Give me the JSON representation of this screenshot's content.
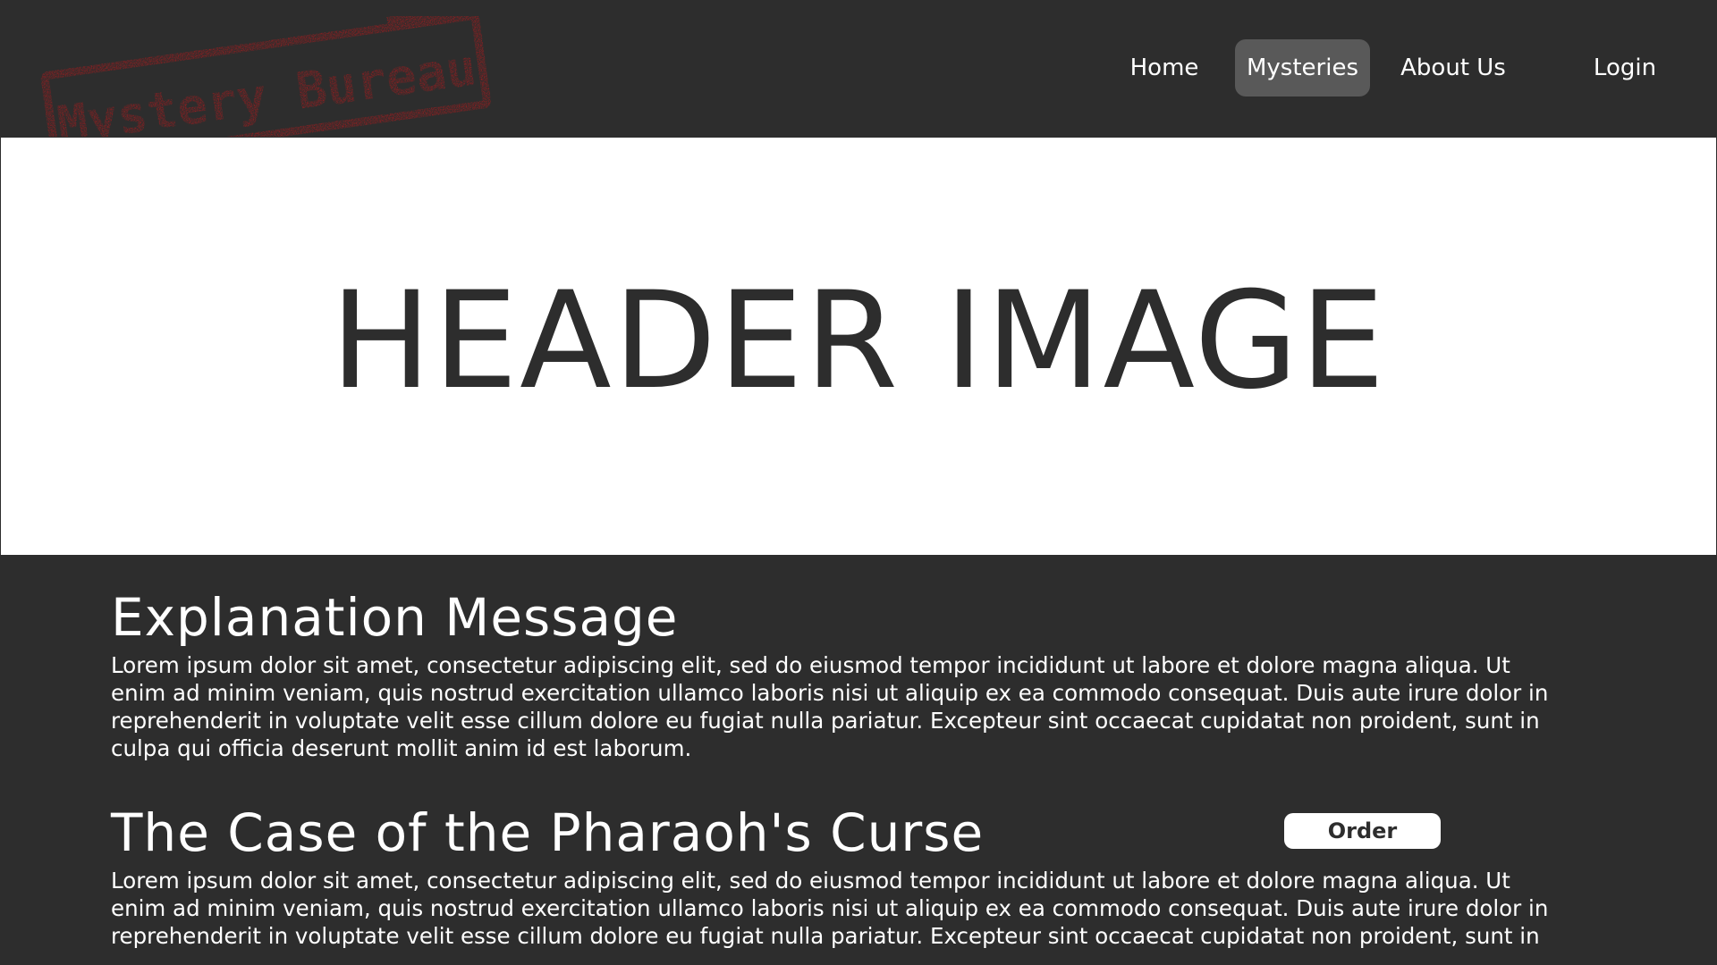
{
  "brand": {
    "logo_text": "Mystery Bureau",
    "logo_color": "#b3191c"
  },
  "nav": {
    "items": [
      {
        "label": "Home"
      },
      {
        "label": "Mysteries",
        "active": true
      },
      {
        "label": "About Us"
      },
      {
        "label": "Login"
      }
    ]
  },
  "hero": {
    "text": "HEADER IMAGE"
  },
  "explanation": {
    "title": "Explanation Message",
    "body": "Lorem ipsum dolor sit amet, consectetur adipiscing elit, sed do eiusmod tempor incididunt ut labore et dolore magna aliqua. Ut enim ad minim veniam, quis nostrud exercitation ullamco laboris nisi ut aliquip ex ea commodo consequat. Duis aute irure dolor in reprehenderit in voluptate velit esse cillum dolore eu fugiat nulla pariatur. Excepteur sint occaecat cupidatat non proident, sunt in culpa qui officia deserunt mollit anim id est laborum."
  },
  "case": {
    "title": "The Case of the Pharaoh's Curse",
    "order_label": "Order",
    "body": "Lorem ipsum dolor sit amet, consectetur adipiscing elit, sed do eiusmod tempor incididunt ut labore et dolore magna aliqua. Ut enim ad minim veniam, quis nostrud exercitation ullamco laboris nisi ut aliquip ex ea commodo consequat. Duis aute irure dolor in reprehenderit in voluptate velit esse cillum dolore eu fugiat nulla pariatur. Excepteur sint occaecat cupidatat non proident, sunt in"
  },
  "colors": {
    "background": "#2d2d2d",
    "nav_active": "#595959",
    "hero_bg": "#ffffff",
    "text": "#ffffff",
    "stamp_red": "#b3191c"
  }
}
